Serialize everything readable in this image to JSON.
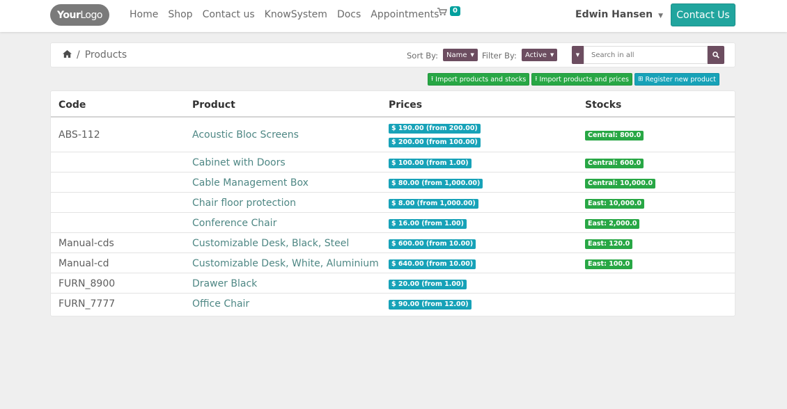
{
  "nav": {
    "logo_bold": "Your",
    "logo_rest": "Logo",
    "links": [
      "Home",
      "Shop",
      "Contact us",
      "KnowSystem",
      "Docs",
      "Appointments"
    ],
    "cart_count": "0",
    "user_name": "Edwin Hansen",
    "contact_button": "Contact Us"
  },
  "breadcrumb": {
    "separator": "/",
    "current": "Products"
  },
  "controls": {
    "sort_label": "Sort By:",
    "sort_value": "Name",
    "filter_label": "Filter By:",
    "filter_value": "Active",
    "search_placeholder": "Search in all"
  },
  "actions": {
    "import_stocks": "Import products and stocks",
    "import_prices": "Import products and prices",
    "register": "Register new product"
  },
  "table": {
    "headers": [
      "Code",
      "Product",
      "Prices",
      "Stocks"
    ],
    "rows": [
      {
        "code": "ABS-112",
        "product": "Acoustic Bloc Screens",
        "prices": [
          "$ 190.00 (from 200.00)",
          "$ 200.00 (from 100.00)"
        ],
        "stocks": [
          "Central: 800.0"
        ]
      },
      {
        "code": "",
        "product": "Cabinet with Doors",
        "prices": [
          "$ 100.00 (from 1.00)"
        ],
        "stocks": [
          "Central: 600.0"
        ]
      },
      {
        "code": "",
        "product": "Cable Management Box",
        "prices": [
          "$ 80.00 (from 1,000.00)"
        ],
        "stocks": [
          "Central: 10,000.0"
        ]
      },
      {
        "code": "",
        "product": "Chair floor protection",
        "prices": [
          "$ 8.00 (from 1,000.00)"
        ],
        "stocks": [
          "East: 10,000.0"
        ]
      },
      {
        "code": "",
        "product": "Conference Chair",
        "prices": [
          "$ 16.00 (from 1.00)"
        ],
        "stocks": [
          "East: 2,000.0"
        ]
      },
      {
        "code": "Manual-cds",
        "product": "Customizable Desk, Black, Steel",
        "prices": [
          "$ 600.00 (from 10.00)"
        ],
        "stocks": [
          "East: 120.0"
        ]
      },
      {
        "code": "Manual-cd",
        "product": "Customizable Desk, White, Aluminium",
        "prices": [
          "$ 640.00 (from 10.00)"
        ],
        "stocks": [
          "East: 100.0"
        ]
      },
      {
        "code": "FURN_8900",
        "product": "Drawer Black",
        "prices": [
          "$ 20.00 (from 1.00)"
        ],
        "stocks": []
      },
      {
        "code": "FURN_7777",
        "product": "Office Chair",
        "prices": [
          "$ 90.00 (from 12.00)"
        ],
        "stocks": []
      }
    ]
  },
  "colors": {
    "primary_purple": "#6c4d60",
    "teal_button": "#21a59e",
    "badge_info": "#17a2b8",
    "badge_success": "#28a745",
    "link_text": "#4e8784"
  }
}
